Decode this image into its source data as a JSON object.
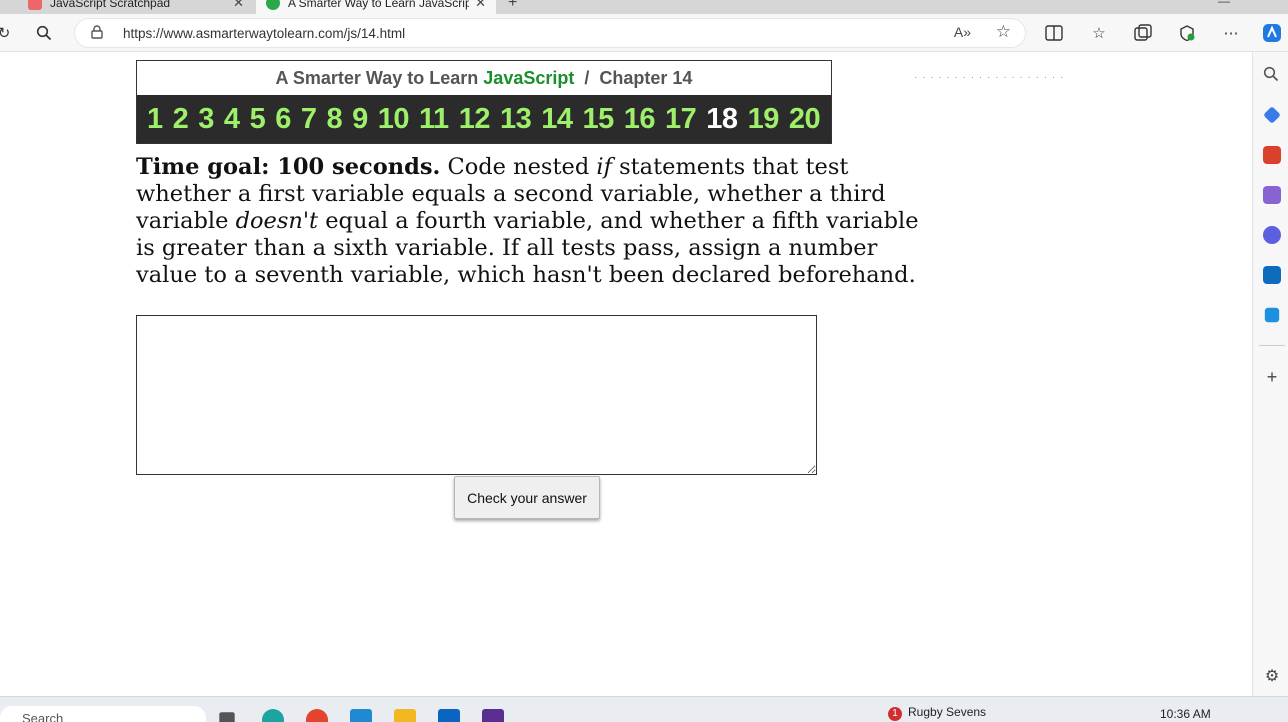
{
  "browser": {
    "tabs": [
      {
        "title": "JavaScript Scratchpad",
        "active": false
      },
      {
        "title": "A Smarter Way to Learn JavaScript",
        "active": true
      }
    ],
    "url": "https://www.asmarterwaytolearn.com/js/14.html"
  },
  "header": {
    "prefix": "A Smarter Way to Learn",
    "brand": "JavaScript",
    "separator": "/",
    "chapter": "Chapter 14"
  },
  "chapters": [
    "1",
    "2",
    "3",
    "4",
    "5",
    "6",
    "7",
    "8",
    "9",
    "10",
    "11",
    "12",
    "13",
    "14",
    "15",
    "16",
    "17",
    "18",
    "19",
    "20"
  ],
  "current_chapter": "18",
  "exercise": {
    "goal": "Time goal: 100 seconds.",
    "text_1": " Code nested ",
    "em_1": "if",
    "text_2": " statements that test whether a first variable equals a second variable, whether a third variable ",
    "em_2": "doesn't",
    "text_3": " equal a fourth variable, and whether a fifth variable is greater than a sixth variable. If all tests pass, assign a number value to a seventh variable, which hasn't been declared beforehand."
  },
  "answer": {
    "value": ""
  },
  "check_button": "Check your answer",
  "taskbar": {
    "search_placeholder": "Search",
    "notification_count": "1",
    "notification": "Rugby Sevens",
    "time": "10:36 AM"
  }
}
